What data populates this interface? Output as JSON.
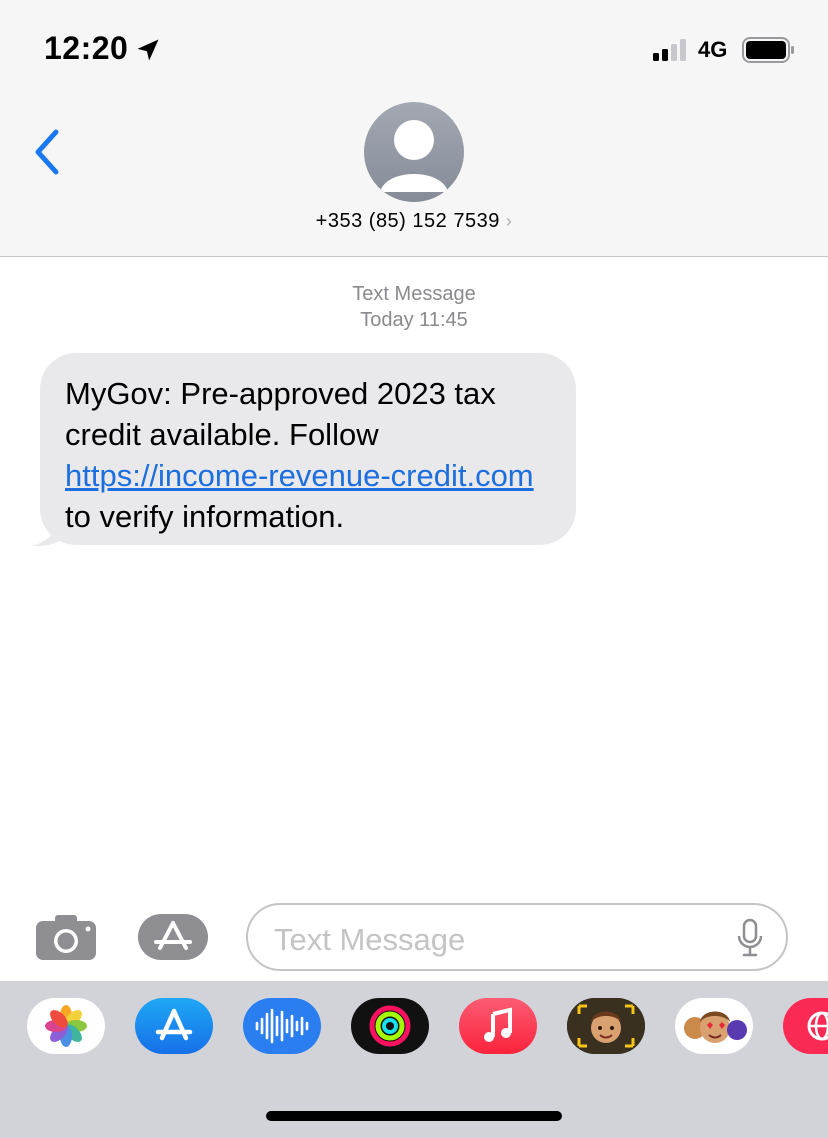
{
  "status_bar": {
    "time": "12:20",
    "network": "4G"
  },
  "header": {
    "contact": "+353 (85) 152 7539",
    "chevron": "›"
  },
  "conversation": {
    "type_label": "Text Message",
    "date_label": "Today 11:45",
    "message": {
      "text_before": "MyGov: Pre-approved 2023 tax credit available. Follow ",
      "link": "https://income-revenue-credit.com",
      "text_after": " to verify information."
    }
  },
  "composer": {
    "placeholder": "Text Message"
  },
  "app_drawer": [
    "photos-icon",
    "app-store-icon",
    "audio-messages-icon",
    "fitness-icon",
    "music-icon",
    "memoji-icon",
    "memoji-stickers-icon",
    "web-search-icon"
  ],
  "colors": {
    "link": "#1d6fe0",
    "accent": "#1a78f2",
    "bubble": "#e9e9eb"
  }
}
